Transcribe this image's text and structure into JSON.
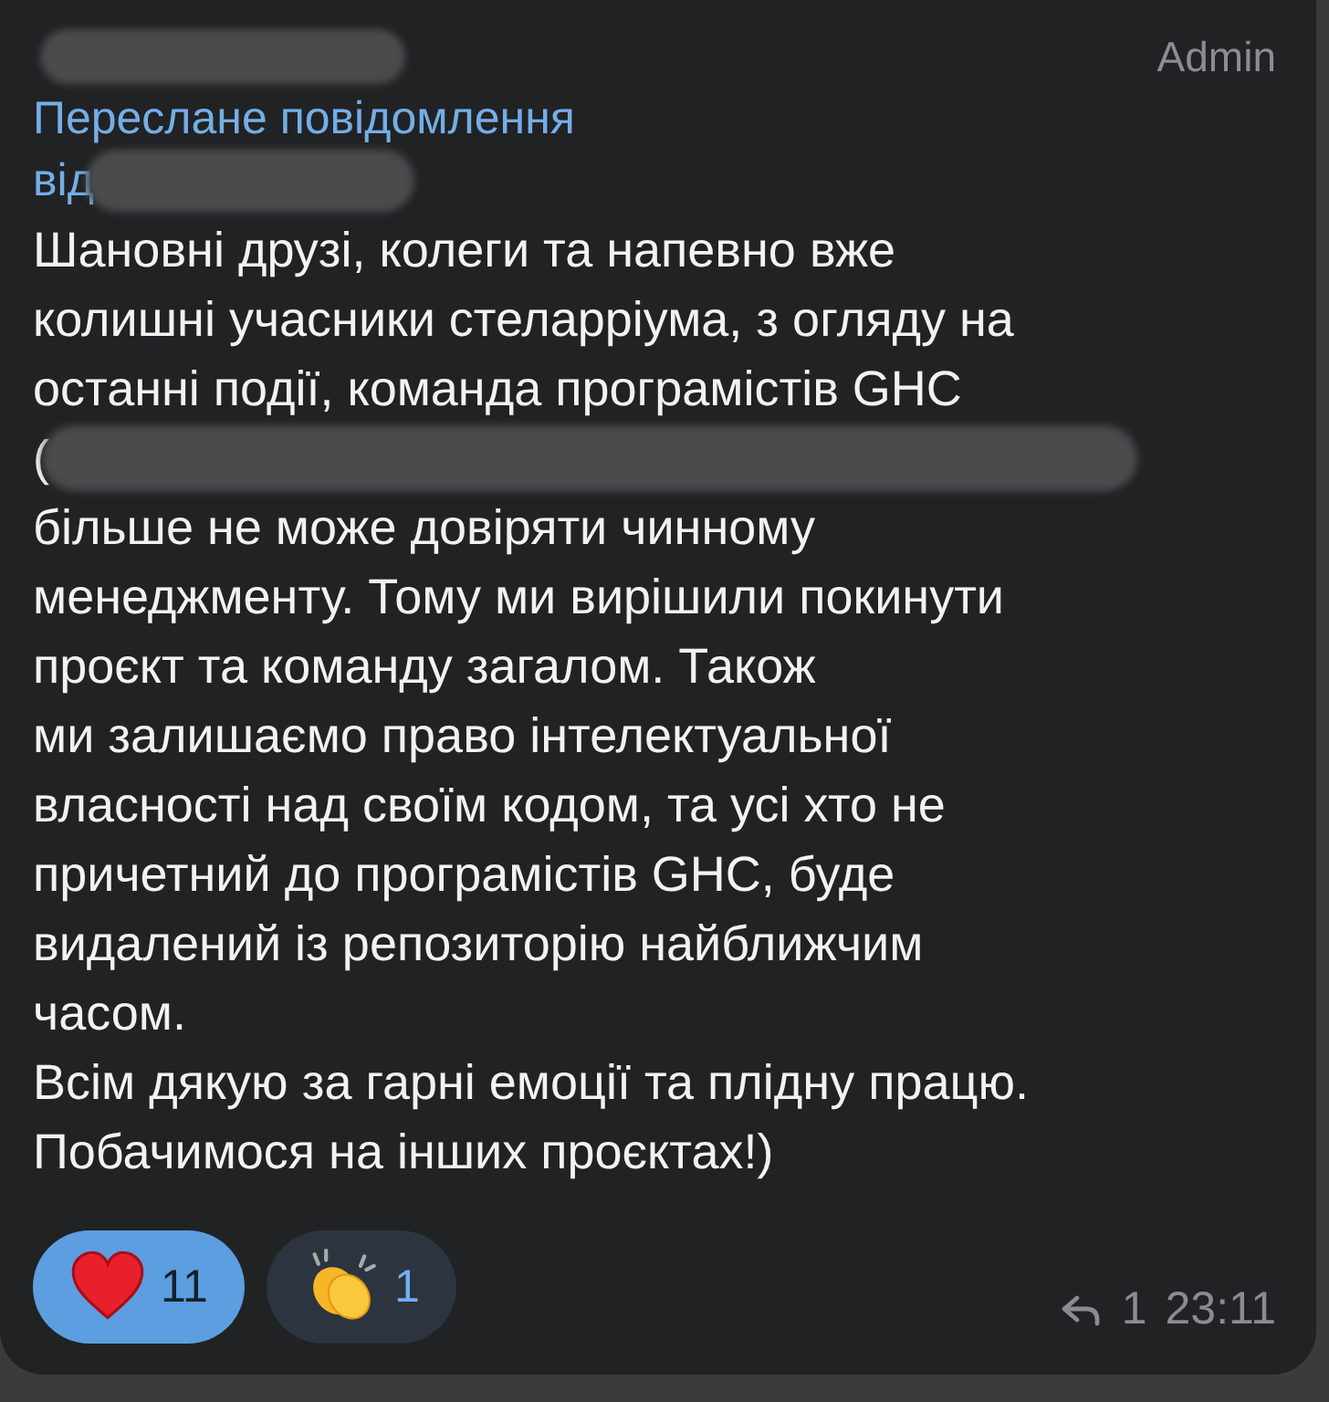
{
  "message": {
    "sender": {
      "redacted": true
    },
    "author_badge": "Admin",
    "forwarded": {
      "label": "Переслане повідомлення",
      "from": "від",
      "from_redacted": true
    },
    "lines": [
      {
        "text": "Шановні друзі, колеги та напевно вже",
        "redacted": false
      },
      {
        "text": "колишні учасники стеларріума, з огляду на",
        "redacted": false
      },
      {
        "text": "останні події, команда програмістів GHC",
        "redacted": false
      },
      {
        "text": "(",
        "redacted": true
      },
      {
        "text": "більше не може довіряти чинному",
        "redacted": false
      },
      {
        "text": "менеджменту. Тому ми вирішили покинути",
        "redacted": false
      },
      {
        "text": "проєкт та команду загалом. Також",
        "redacted": false
      },
      {
        "text": "ми залишаємо право інтелектуальної",
        "redacted": false
      },
      {
        "text": "власності над своїм кодом, та усі хто не",
        "redacted": false
      },
      {
        "text": "причетний до програмістів GHC, буде",
        "redacted": false
      },
      {
        "text": "видалений із репозиторію найближчим",
        "redacted": false
      },
      {
        "text": "часом.",
        "redacted": false
      },
      {
        "text": "Всім дякую за гарні емоції та плідну працю.",
        "redacted": false
      },
      {
        "text": "Побачимося на інших проєктах!)",
        "redacted": false
      }
    ],
    "reactions": [
      {
        "kind": "heart",
        "count": "11",
        "selected": true
      },
      {
        "kind": "clap",
        "count": "1",
        "selected": false
      }
    ],
    "replies": "1",
    "time": "23:11"
  }
}
